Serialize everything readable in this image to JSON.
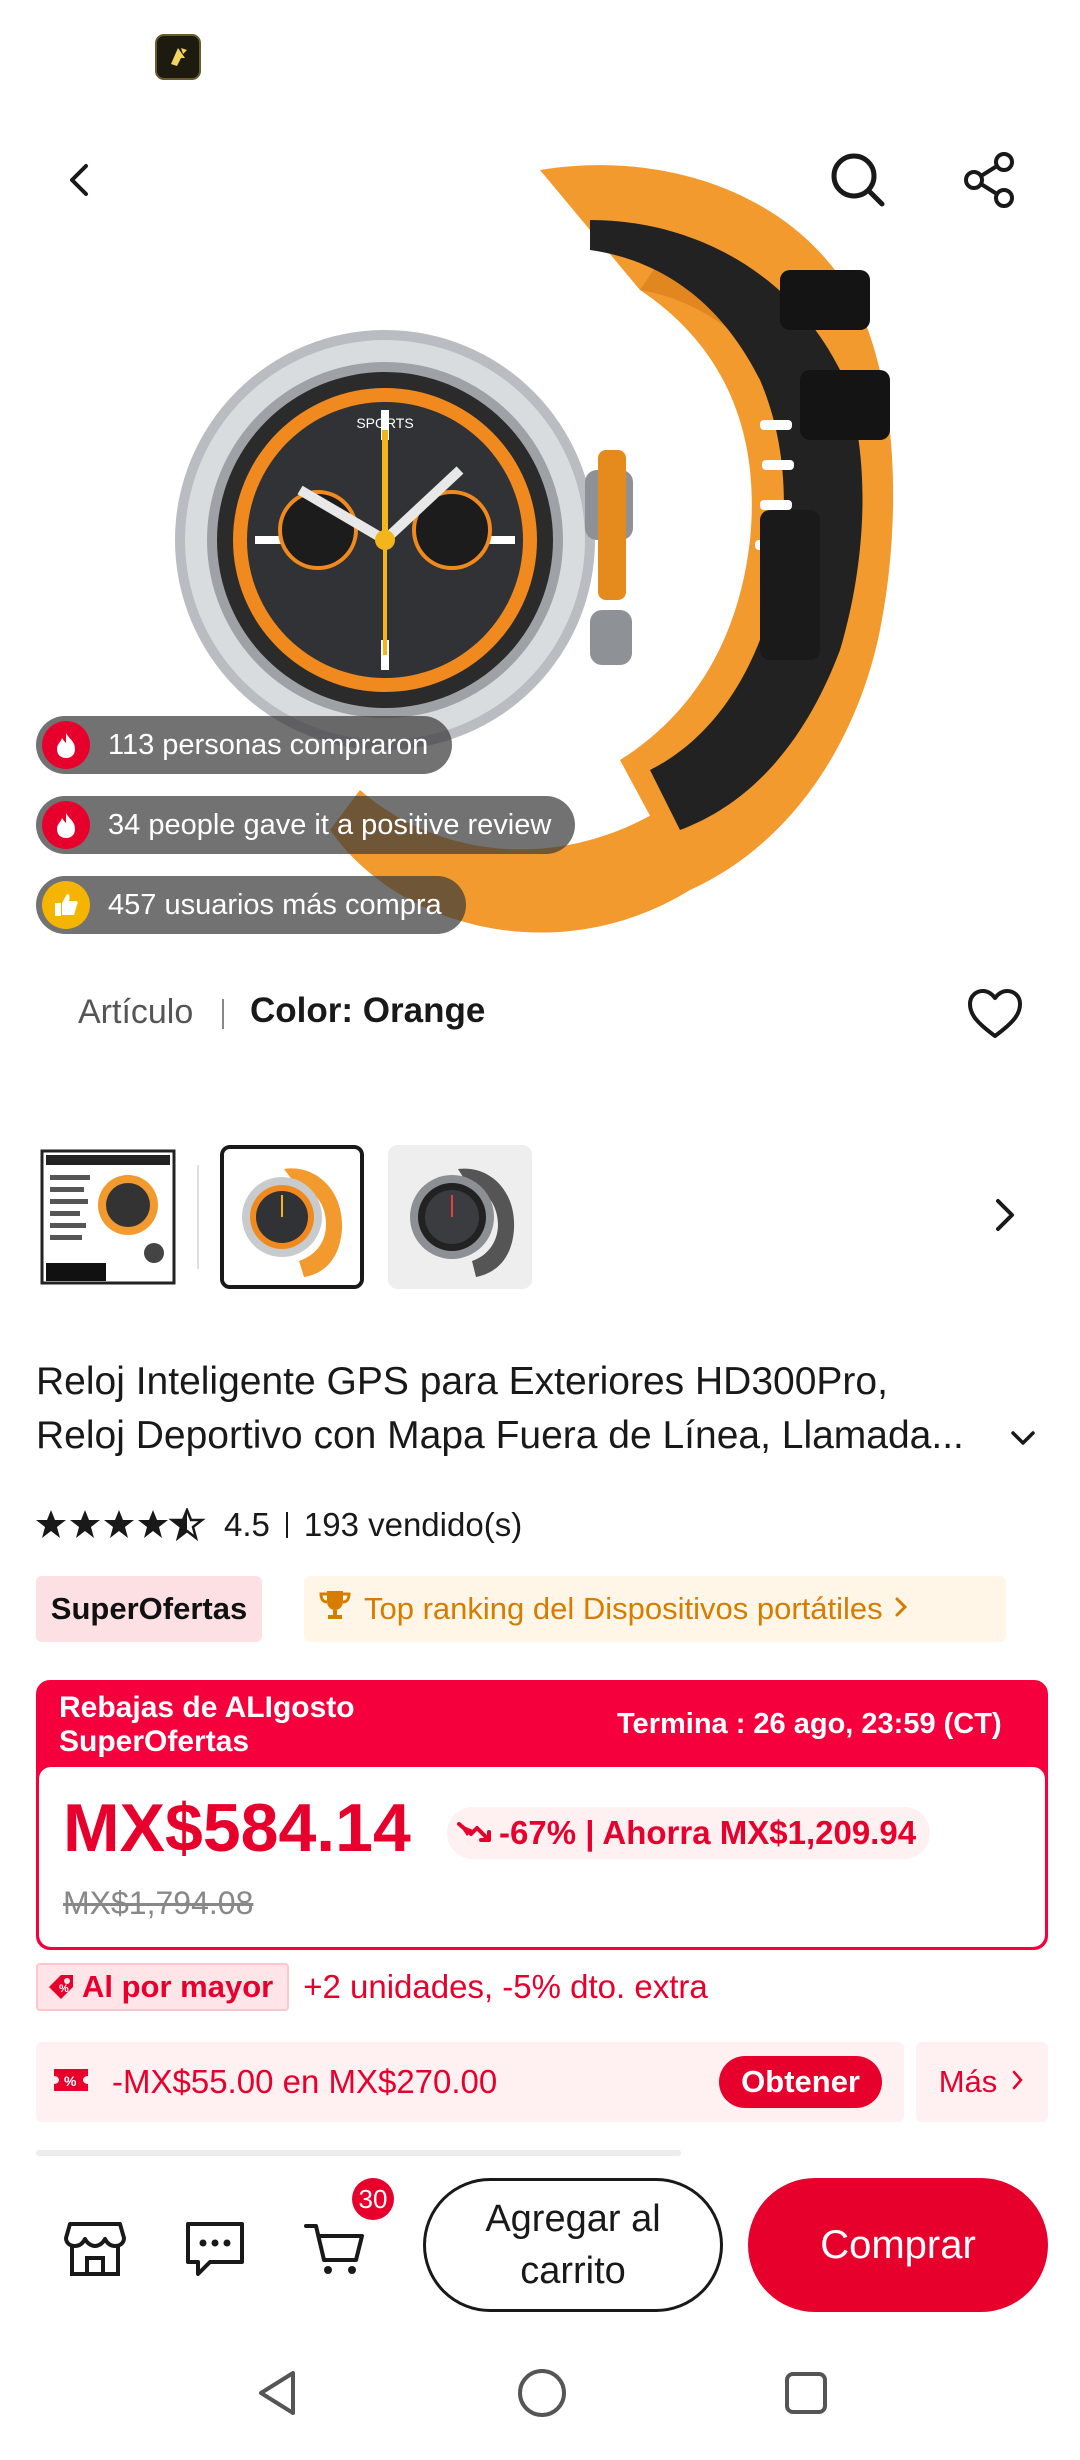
{
  "colors": {
    "accent": "#e8002d",
    "deal_red": "#f5003d",
    "strap_orange": "#f29a2e",
    "rank_orange": "#d67d00",
    "text": "#191919"
  },
  "status_bar": {
    "app_icon": "sketch-app-icon"
  },
  "header": {
    "back_icon": "back-arrow-icon",
    "search_icon": "search-icon",
    "share_icon": "share-icon"
  },
  "social_proof": [
    {
      "icon": "fire-icon",
      "text": "113 personas compraron"
    },
    {
      "icon": "fire-icon",
      "text": "34 people gave it a positive review"
    },
    {
      "icon": "thumbs-up-icon",
      "text": "457 usuarios más compra"
    }
  ],
  "variant": {
    "label": "Artículo",
    "color_text": "Color: Orange"
  },
  "thumbnails": [
    {
      "name": "thumbnail-spec-sheet",
      "selected": false
    },
    {
      "name": "thumbnail-orange",
      "selected": true
    },
    {
      "name": "thumbnail-black",
      "selected": false
    }
  ],
  "product": {
    "title_line1": "Reloj Inteligente GPS para Exteriores HD300Pro,",
    "title_line2": "Reloj Deportivo con Mapa Fuera de Línea, Llamada...",
    "rating": "4.5",
    "rating_stars": 4.5,
    "sold": "193 vendido(s)"
  },
  "badges": {
    "super": "SuperOfertas",
    "ranking": "Top ranking del Dispositivos portátiles"
  },
  "deal": {
    "header_line1": "Rebajas de ALIgosto",
    "header_line2": "SuperOfertas",
    "ends": "Termina :  26 ago, 23:59 (CT)",
    "price": "MX$584.14",
    "discount": "-67% | Ahorra MX$1,209.94",
    "original_price": "MX$1,794.08"
  },
  "wholesale": {
    "tag": "Al por mayor",
    "text": "+2 unidades, -5% dto. extra"
  },
  "coupon": {
    "text": "-MX$55.00 en MX$270.00",
    "get_label": "Obtener",
    "more_label": "Más"
  },
  "bottom_bar": {
    "cart_count": "30",
    "add_to_cart_line1": "Agregar al",
    "add_to_cart_line2": "carrito",
    "buy_label": "Comprar"
  }
}
